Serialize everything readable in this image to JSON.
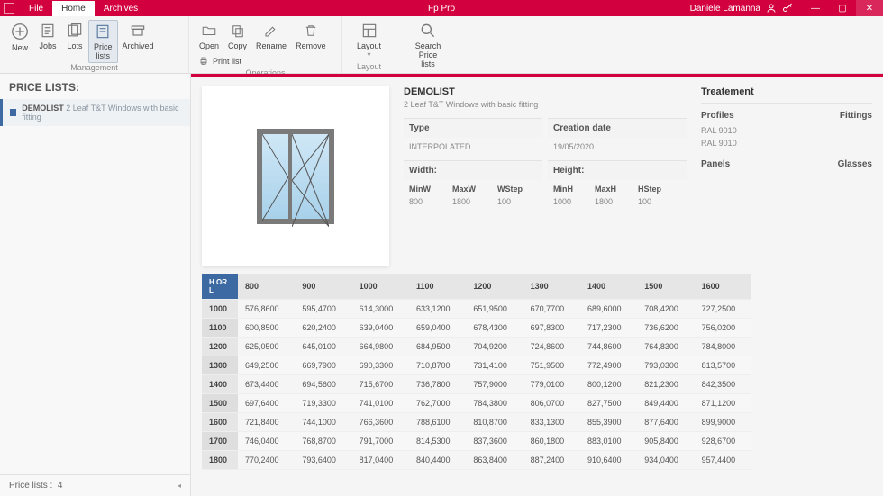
{
  "app": {
    "title": "Fp Pro"
  },
  "user": {
    "name": "Daniele Lamanna"
  },
  "top_tabs": {
    "file": "File",
    "home": "Home",
    "archives": "Archives"
  },
  "ribbon": {
    "management": {
      "label": "Management",
      "new": "New",
      "jobs": "Jobs",
      "lots": "Lots",
      "price_lists": "Price\nlists",
      "archived": "Archived"
    },
    "operations": {
      "label": "Operations",
      "open": "Open",
      "copy": "Copy",
      "rename": "Rename",
      "remove": "Remove",
      "print_list": "Print list"
    },
    "layout": {
      "label": "Layout",
      "layout": "Layout"
    },
    "search": {
      "label": "Search Price\nlists"
    }
  },
  "sidebar": {
    "header": "PRICE LISTS:",
    "items": [
      {
        "name": "DEMOLIST",
        "desc": "2 Leaf T&T Windows with basic fitting"
      }
    ],
    "footer_label": "Price lists :",
    "footer_count": "4"
  },
  "detail": {
    "title": "DEMOLIST",
    "subtitle": "2 Leaf T&T Windows with basic fitting",
    "type_label": "Type",
    "type_value": "INTERPOLATED",
    "date_label": "Creation date",
    "date_value": "19/05/2020",
    "width_label": "Width:",
    "height_label": "Height:",
    "minw_h": "MinW",
    "maxw_h": "MaxW",
    "wstep_h": "WStep",
    "minh_h": "MinH",
    "maxh_h": "MaxH",
    "hstep_h": "HStep",
    "minw": "800",
    "maxw": "1800",
    "wstep": "100",
    "minh": "1000",
    "maxh": "1800",
    "hstep": "100"
  },
  "treatment": {
    "header": "Treatement",
    "profiles": "Profiles",
    "fittings": "Fittings",
    "ral1": "RAL 9010",
    "ral2": "RAL 9010",
    "panels": "Panels",
    "glasses": "Glasses"
  },
  "table": {
    "corner": "H OR L",
    "cols": [
      "800",
      "900",
      "1000",
      "1100",
      "1200",
      "1300",
      "1400",
      "1500",
      "1600"
    ],
    "rows": [
      {
        "h": "1000",
        "v": [
          "576,8600",
          "595,4700",
          "614,3000",
          "633,1200",
          "651,9500",
          "670,7700",
          "689,6000",
          "708,4200",
          "727,2500"
        ]
      },
      {
        "h": "1100",
        "v": [
          "600,8500",
          "620,2400",
          "639,0400",
          "659,0400",
          "678,4300",
          "697,8300",
          "717,2300",
          "736,6200",
          "756,0200"
        ]
      },
      {
        "h": "1200",
        "v": [
          "625,0500",
          "645,0100",
          "664,9800",
          "684,9500",
          "704,9200",
          "724,8600",
          "744,8600",
          "764,8300",
          "784,8000"
        ]
      },
      {
        "h": "1300",
        "v": [
          "649,2500",
          "669,7900",
          "690,3300",
          "710,8700",
          "731,4100",
          "751,9500",
          "772,4900",
          "793,0300",
          "813,5700"
        ]
      },
      {
        "h": "1400",
        "v": [
          "673,4400",
          "694,5600",
          "715,6700",
          "736,7800",
          "757,9000",
          "779,0100",
          "800,1200",
          "821,2300",
          "842,3500"
        ]
      },
      {
        "h": "1500",
        "v": [
          "697,6400",
          "719,3300",
          "741,0100",
          "762,7000",
          "784,3800",
          "806,0700",
          "827,7500",
          "849,4400",
          "871,1200"
        ]
      },
      {
        "h": "1600",
        "v": [
          "721,8400",
          "744,1000",
          "766,3600",
          "788,6100",
          "810,8700",
          "833,1300",
          "855,3900",
          "877,6400",
          "899,9000"
        ]
      },
      {
        "h": "1700",
        "v": [
          "746,0400",
          "768,8700",
          "791,7000",
          "814,5300",
          "837,3600",
          "860,1800",
          "883,0100",
          "905,8400",
          "928,6700"
        ]
      },
      {
        "h": "1800",
        "v": [
          "770,2400",
          "793,6400",
          "817,0400",
          "840,4400",
          "863,8400",
          "887,2400",
          "910,6400",
          "934,0400",
          "957,4400"
        ]
      }
    ]
  }
}
